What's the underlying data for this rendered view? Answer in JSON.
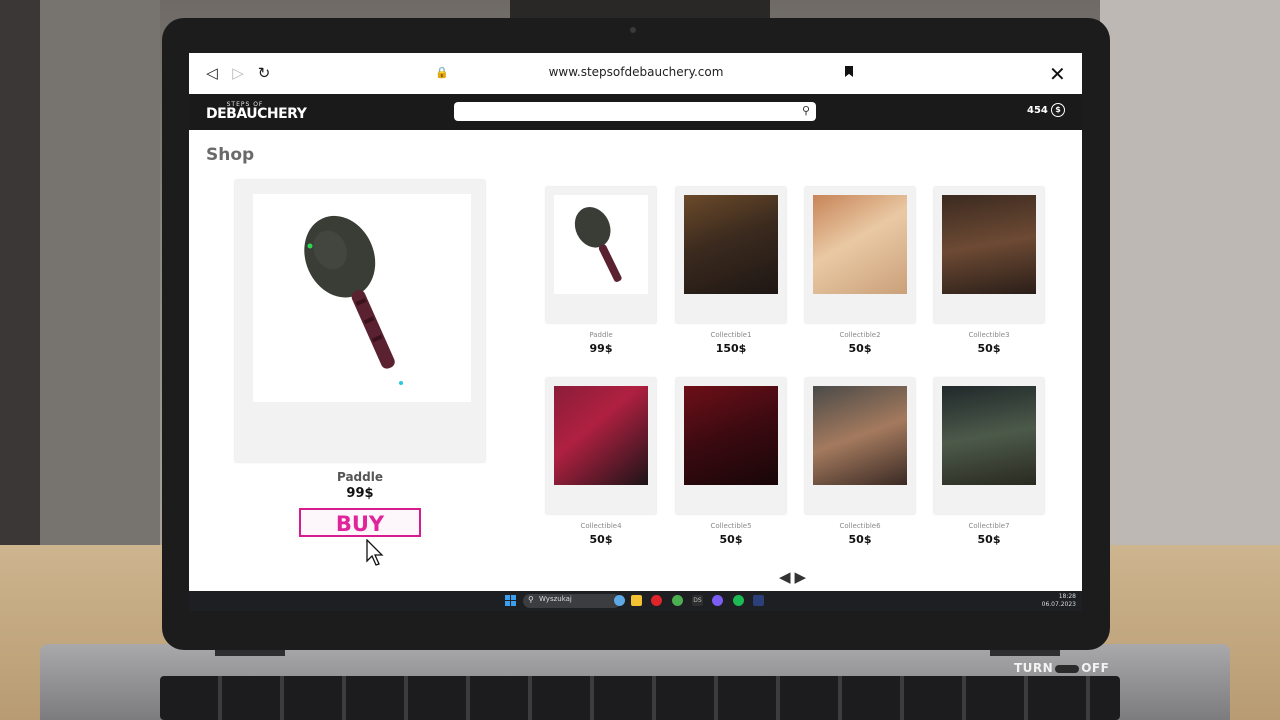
{
  "browser": {
    "url": "www.stepsofdebauchery.com"
  },
  "header": {
    "logo_top": "STEPS OF",
    "logo_main": "DEBAUCHERY",
    "search_value": "",
    "balance": "454"
  },
  "shop": {
    "title": "Shop",
    "featured": {
      "name": "Paddle",
      "price": "99$",
      "buy_label": "BUY"
    },
    "items": [
      {
        "name": "Paddle",
        "price": "99$"
      },
      {
        "name": "Collectible1",
        "price": "150$"
      },
      {
        "name": "Collectible2",
        "price": "50$"
      },
      {
        "name": "Collectible3",
        "price": "50$"
      },
      {
        "name": "Collectible4",
        "price": "50$"
      },
      {
        "name": "Collectible5",
        "price": "50$"
      },
      {
        "name": "Collectible6",
        "price": "50$"
      },
      {
        "name": "Collectible7",
        "price": "50$"
      }
    ]
  },
  "taskbar": {
    "search_placeholder": "Wyszukaj",
    "time": "18:28",
    "date": "06.07.2023"
  },
  "overlay": {
    "brand_left": "TURN",
    "brand_right": "OFF"
  },
  "colors": {
    "buy_accent": "#e0249b",
    "header_bg": "#1a1a1b"
  }
}
